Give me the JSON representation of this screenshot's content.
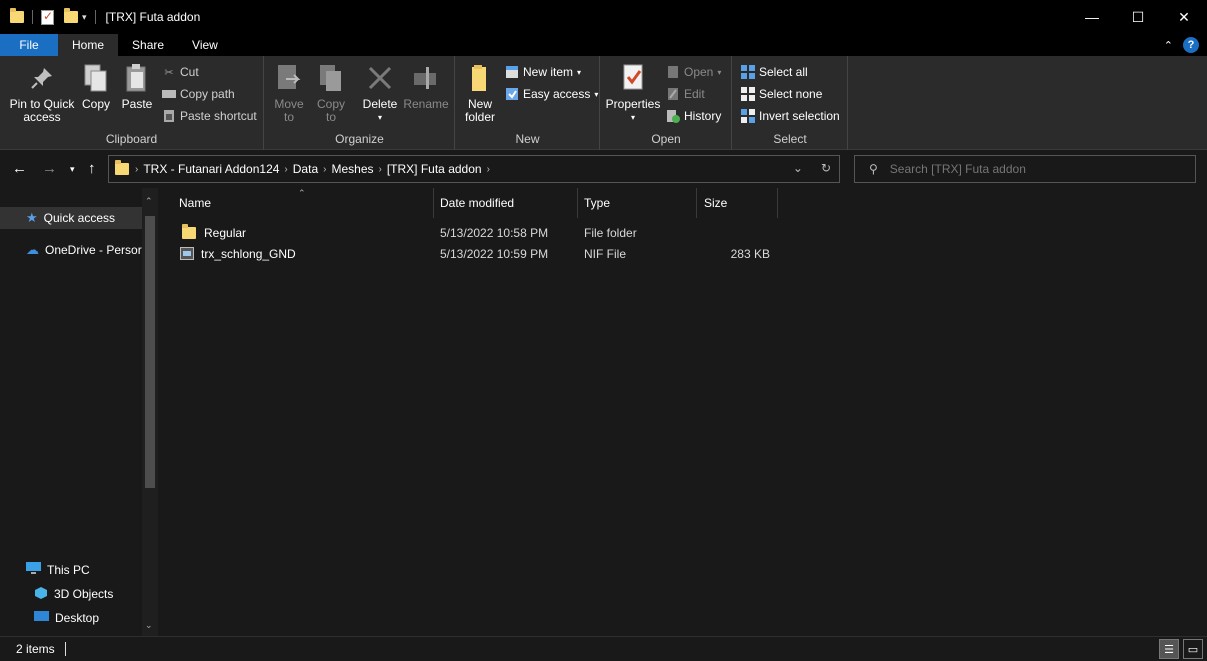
{
  "window": {
    "title": "[TRX] Futa addon",
    "minimize": "—",
    "maximize": "☐",
    "close": "✕"
  },
  "tabs": [
    {
      "label": "File"
    },
    {
      "label": "Home"
    },
    {
      "label": "Share"
    },
    {
      "label": "View"
    }
  ],
  "ribbon": {
    "clipboard": {
      "label": "Clipboard",
      "pin": "Pin to Quick access",
      "pin_l1": "Pin to Quick",
      "pin_l2": "access",
      "copy": "Copy",
      "paste": "Paste",
      "cut": "Cut",
      "copy_path": "Copy path",
      "paste_shortcut": "Paste shortcut"
    },
    "organize": {
      "label": "Organize",
      "move_l1": "Move",
      "move_l2": "to",
      "copy_l1": "Copy",
      "copy_l2": "to",
      "delete": "Delete",
      "rename": "Rename"
    },
    "new": {
      "label": "New",
      "folder_l1": "New",
      "folder_l2": "folder",
      "new_item": "New item",
      "easy_access": "Easy access"
    },
    "open": {
      "label": "Open",
      "properties": "Properties",
      "open": "Open",
      "edit": "Edit",
      "history": "History"
    },
    "select": {
      "label": "Select",
      "select_all": "Select all",
      "select_none": "Select none",
      "invert": "Invert selection"
    }
  },
  "address": {
    "crumbs": [
      "TRX - Futanari Addon124",
      "Data",
      "Meshes",
      "[TRX] Futa addon"
    ]
  },
  "search": {
    "placeholder": "Search [TRX] Futa addon"
  },
  "nav": {
    "quick_access": "Quick access",
    "onedrive": "OneDrive - Persor",
    "this_pc": "This PC",
    "objects3d": "3D Objects",
    "desktop": "Desktop"
  },
  "columns": {
    "name": "Name",
    "date": "Date modified",
    "type": "Type",
    "size": "Size"
  },
  "files": [
    {
      "name": "Regular",
      "date": "5/13/2022 10:58 PM",
      "type": "File folder",
      "size": ""
    },
    {
      "name": "trx_schlong_GND",
      "date": "5/13/2022 10:59 PM",
      "type": "NIF File",
      "size": "283 KB"
    }
  ],
  "status": {
    "count": "2 items"
  },
  "colors": {
    "accent": "#1a6fc2",
    "folder": "#f8d775",
    "background": "#191919",
    "ribbon": "#2b2b2b"
  }
}
